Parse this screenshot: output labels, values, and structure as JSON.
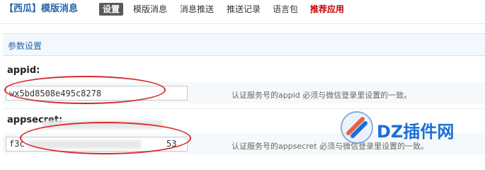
{
  "header": {
    "brand": "【西瓜】模版消息",
    "tabs": [
      {
        "label": "设置",
        "active": true
      },
      {
        "label": "模版消息",
        "active": false
      },
      {
        "label": "消息推送",
        "active": false
      },
      {
        "label": "推送记录",
        "active": false
      },
      {
        "label": "语言包",
        "active": false
      },
      {
        "label": "推荐应用",
        "active": false,
        "highlight": true
      }
    ]
  },
  "section": {
    "title": "参数设置"
  },
  "fields": [
    {
      "label": "appid:",
      "value": "wx5bd8508e495c8278",
      "description": "认证服务号的appid 必须与微信登录里设置的一致。"
    },
    {
      "label": "appsecret:",
      "value_start": "f3c",
      "value_end": "53",
      "description": "认证服务号的appsecret 必须与微信登录里设置的一致。"
    }
  ],
  "watermark": {
    "text": "DZ插件网"
  },
  "colors": {
    "brand": "#2366a8",
    "active_tab_bg": "#5a5a5a",
    "highlight_tab": "#c40000",
    "annotation": "#d42a2a",
    "watermark": "#1a6fd6"
  }
}
